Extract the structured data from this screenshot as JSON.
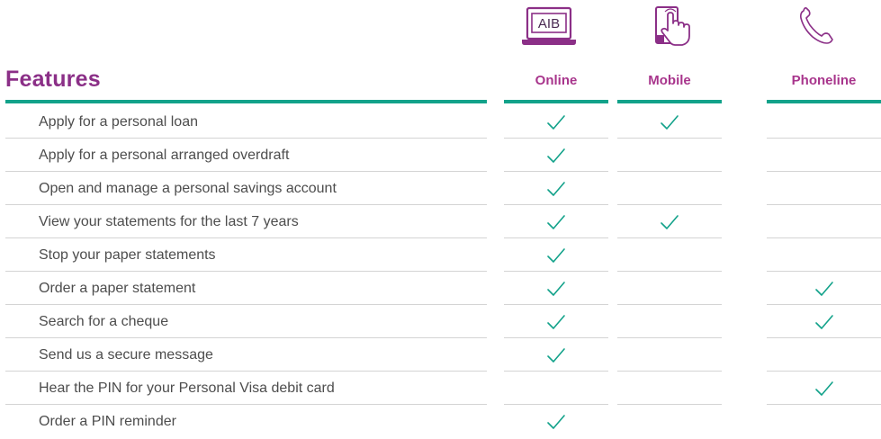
{
  "header": {
    "title": "Features",
    "online_icon_text": "AIB",
    "channels": [
      {
        "label": "Online",
        "icon": "laptop-icon"
      },
      {
        "label": "Mobile",
        "icon": "mobile-tap-icon"
      },
      {
        "label": "Phoneline",
        "icon": "phone-icon"
      }
    ]
  },
  "colors": {
    "title": "#8b2f87",
    "channel_label": "#a8358c",
    "accent_rule": "#12a28a",
    "check": "#12a28a",
    "row_rule": "#d4d4d4",
    "text": "#4d4d4d"
  },
  "features": [
    {
      "label": "Apply for a personal loan",
      "online": true,
      "mobile": true,
      "phoneline": false
    },
    {
      "label": "Apply for a personal arranged overdraft",
      "online": true,
      "mobile": false,
      "phoneline": false
    },
    {
      "label": "Open and manage a personal savings account",
      "online": true,
      "mobile": false,
      "phoneline": false
    },
    {
      "label": "View your statements for the last 7 years",
      "online": true,
      "mobile": true,
      "phoneline": false
    },
    {
      "label": "Stop your paper statements",
      "online": true,
      "mobile": false,
      "phoneline": false
    },
    {
      "label": "Order a paper statement",
      "online": true,
      "mobile": false,
      "phoneline": true
    },
    {
      "label": "Search for a cheque",
      "online": true,
      "mobile": false,
      "phoneline": true
    },
    {
      "label": "Send us a secure message",
      "online": true,
      "mobile": false,
      "phoneline": false
    },
    {
      "label": "Hear the PIN for your Personal Visa debit card",
      "online": false,
      "mobile": false,
      "phoneline": true
    },
    {
      "label": "Order a PIN reminder",
      "online": true,
      "mobile": false,
      "phoneline": false
    }
  ]
}
